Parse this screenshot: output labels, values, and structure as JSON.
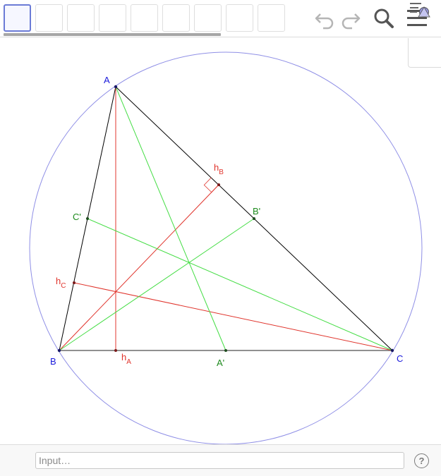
{
  "toolbar": {
    "tools": [
      {
        "name": "tool-move",
        "selected": true
      },
      {
        "name": "tool-point",
        "selected": false
      },
      {
        "name": "tool-line",
        "selected": false
      },
      {
        "name": "tool-perpendicular",
        "selected": false
      },
      {
        "name": "tool-polygon",
        "selected": false
      },
      {
        "name": "tool-circle",
        "selected": false
      },
      {
        "name": "tool-ellipse",
        "selected": false
      },
      {
        "name": "tool-angle",
        "selected": false
      },
      {
        "name": "tool-reflect",
        "selected": false
      }
    ],
    "icons": {
      "undo": "undo-icon",
      "redo": "redo-icon",
      "search": "search-icon",
      "menu": "menu-icon",
      "stylebar": "stylebar-toggle-icon"
    }
  },
  "construction": {
    "points": {
      "A": "A",
      "B": "B",
      "C": "C",
      "A_prime": "A'",
      "B_prime": "B'",
      "C_prime": "C'",
      "hA": {
        "base": "h",
        "sub": "A"
      },
      "hB": {
        "base": "h",
        "sub": "B"
      },
      "hC": {
        "base": "h",
        "sub": "C"
      }
    },
    "colors": {
      "vertex": "#1a1adb",
      "altitude": "#e0342c",
      "median": "#2fbe2f",
      "median_label": "#1c8a1c",
      "triangle": "#000000",
      "circumcircle": "#8f8fe6",
      "base_side": "#6b6b6b"
    }
  },
  "inputbar": {
    "placeholder": "Input…",
    "help": "?"
  }
}
